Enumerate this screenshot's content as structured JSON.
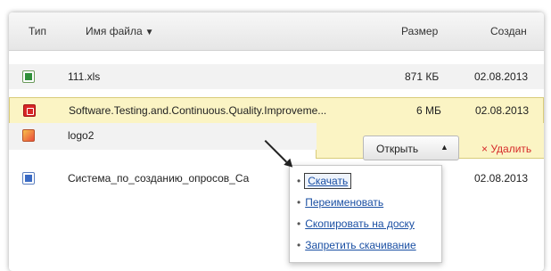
{
  "header": {
    "col_type": "Тип",
    "col_filename": "Имя файла",
    "col_filename_sort": "▼",
    "col_size": "Размер",
    "col_created": "Создан"
  },
  "files": [
    {
      "name": "111.xls",
      "size": "871 КБ",
      "created": "02.08.2013",
      "icon": "xls-icon"
    },
    {
      "name": "Software.Testing.and.Continuous.Quality.Improveme...",
      "size": "6 МБ",
      "created": "02.08.2013",
      "icon": "pdf-icon"
    },
    {
      "name": "logo2",
      "size": "",
      "created": "",
      "icon": "image-icon"
    },
    {
      "name": "Система_по_созданию_опросов_Са",
      "size": "",
      "created": "02.08.2013",
      "icon": "doc-icon"
    }
  ],
  "actions": {
    "open_label": "Открыть",
    "open_caret": "▲",
    "delete_label": "× Удалить"
  },
  "menu": [
    {
      "label": "Скачать"
    },
    {
      "label": "Переименовать"
    },
    {
      "label": "Скопировать на доску"
    },
    {
      "label": "Запретить скачивание"
    }
  ],
  "colors": {
    "selected_row": "#fbf4c4",
    "link": "#1a4fa3",
    "delete": "#d62a2a"
  }
}
